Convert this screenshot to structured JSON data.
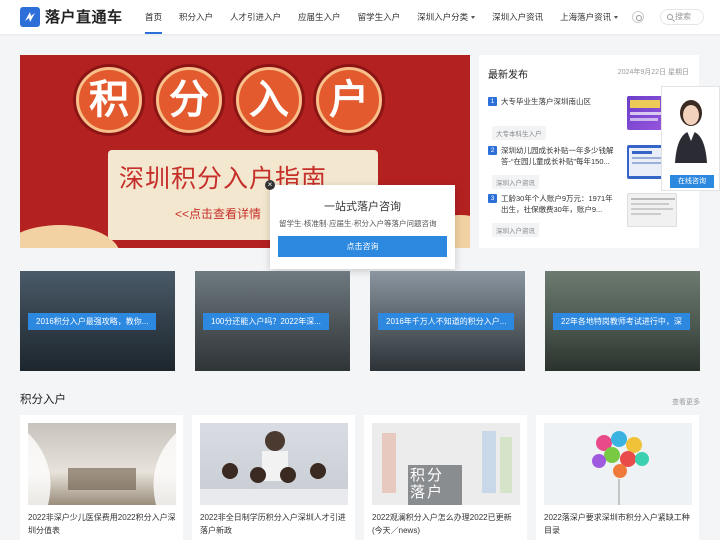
{
  "site": {
    "name": "落户直通车"
  },
  "nav": {
    "items": [
      {
        "label": "首页",
        "active": true,
        "dropdown": false
      },
      {
        "label": "积分入户",
        "active": false,
        "dropdown": false
      },
      {
        "label": "人才引进入户",
        "active": false,
        "dropdown": false
      },
      {
        "label": "应届生入户",
        "active": false,
        "dropdown": false
      },
      {
        "label": "留学生入户",
        "active": false,
        "dropdown": false
      },
      {
        "label": "深圳入户分类",
        "active": false,
        "dropdown": true
      },
      {
        "label": "深圳入户资讯",
        "active": false,
        "dropdown": false
      },
      {
        "label": "上海落户资讯",
        "active": false,
        "dropdown": true
      }
    ],
    "search_label": "搜索"
  },
  "banner": {
    "chars": [
      "积",
      "分",
      "入",
      "户"
    ],
    "title": "深圳积分入户指南",
    "subtitle": "<<点击查看详情"
  },
  "latest": {
    "title": "最新发布",
    "date": "2024年9月22日 星期日",
    "items": [
      {
        "num": "1",
        "text": "大专毕业生落户深圳南山区",
        "tag": "大专本科生入户"
      },
      {
        "num": "2",
        "text": "深圳幼儿园成长补贴一年多少钱解答-“在园儿童成长补贴”每年150...",
        "tag": "深圳入户资讯"
      },
      {
        "num": "3",
        "text": "工龄30年个人账户9万元：1971年出生，社保缴费30年，账户9...",
        "tag": "深圳入户资讯"
      }
    ]
  },
  "service": {
    "button": "在线咨询"
  },
  "popup": {
    "title": "一站式落户咨询",
    "desc": "留学生·核准制·应届生·积分入户等落户问题咨询",
    "button": "点击咨询",
    "close": "×"
  },
  "tiles": [
    {
      "label": "2016积分入户最强攻略，教你..."
    },
    {
      "label": "100分还能入户吗？2022年深..."
    },
    {
      "label": "2016年千万人不知道的积分入户..."
    },
    {
      "label": "22年各地特岗教师考试进行中，深"
    }
  ],
  "section": {
    "title": "积分入户",
    "more": "查看更多",
    "cards": [
      {
        "text": "2022非深户少儿医保费用2022积分入户深圳分值表"
      },
      {
        "text": "2022非全日制学历积分入户深圳人才引进落户新政"
      },
      {
        "text": "2022观澜积分入户怎么办理2022已更新(今天／news)",
        "img_text": "积分落户"
      },
      {
        "text": "2022落深户要求深圳市积分入户紧缺工种目录"
      }
    ]
  },
  "colors": {
    "accent": "#2d88e0",
    "banner_red": "#b42121"
  }
}
